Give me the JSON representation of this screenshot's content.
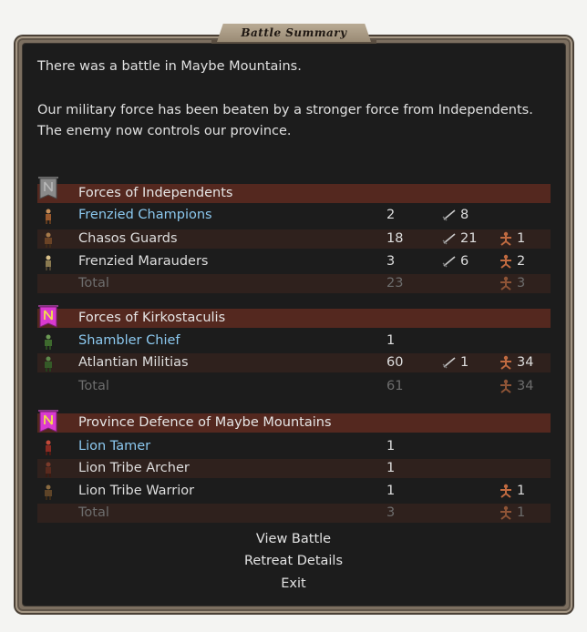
{
  "window": {
    "title": "Battle Summary"
  },
  "intro": {
    "line1": "There was a battle in Maybe Mountains.",
    "line2": "Our military force has been beaten by a stronger force from Independents. The enemy now controls our province."
  },
  "sections": [
    {
      "header": "Forces of Independents",
      "rows": [
        {
          "name": "Frenzied Champions",
          "count": "2",
          "kills": "8",
          "losses": ""
        },
        {
          "name": "Chasos Guards",
          "count": "18",
          "kills": "21",
          "losses": "1"
        },
        {
          "name": "Frenzied Marauders",
          "count": "3",
          "kills": "6",
          "losses": "2"
        }
      ],
      "total": {
        "label": "Total",
        "count": "23",
        "losses": "3"
      }
    },
    {
      "header": "Forces of Kirkostaculis",
      "rows": [
        {
          "name": "Shambler Chief",
          "count": "1",
          "kills": "",
          "losses": ""
        },
        {
          "name": "Atlantian Militias",
          "count": "60",
          "kills": "1",
          "losses": "34"
        }
      ],
      "total": {
        "label": "Total",
        "count": "61",
        "losses": "34"
      }
    },
    {
      "header": "Province Defence of Maybe Mountains",
      "rows": [
        {
          "name": "Lion Tamer",
          "count": "1",
          "kills": "",
          "losses": ""
        },
        {
          "name": "Lion Tribe Archer",
          "count": "1",
          "kills": "",
          "losses": ""
        },
        {
          "name": "Lion Tribe Warrior",
          "count": "1",
          "kills": "",
          "losses": "1"
        }
      ],
      "total": {
        "label": "Total",
        "count": "3",
        "losses": "1"
      }
    }
  ],
  "buttons": {
    "view_battle": "View Battle",
    "retreat_details": "Retreat Details",
    "exit": "Exit"
  },
  "icons": {
    "kills": "sword-icon",
    "losses": "fallen-soldier-icon",
    "banner_independents": "grey-banner-icon",
    "banner_player": "magenta-banner-icon"
  },
  "colors": {
    "header_bg": "#54281f",
    "row_shade": "#2f211d",
    "hero_name": "#8cc9f0",
    "total_text": "#6d6d6d",
    "banner_grey": "#8a8a8a",
    "banner_magenta": "#d93ad0"
  }
}
